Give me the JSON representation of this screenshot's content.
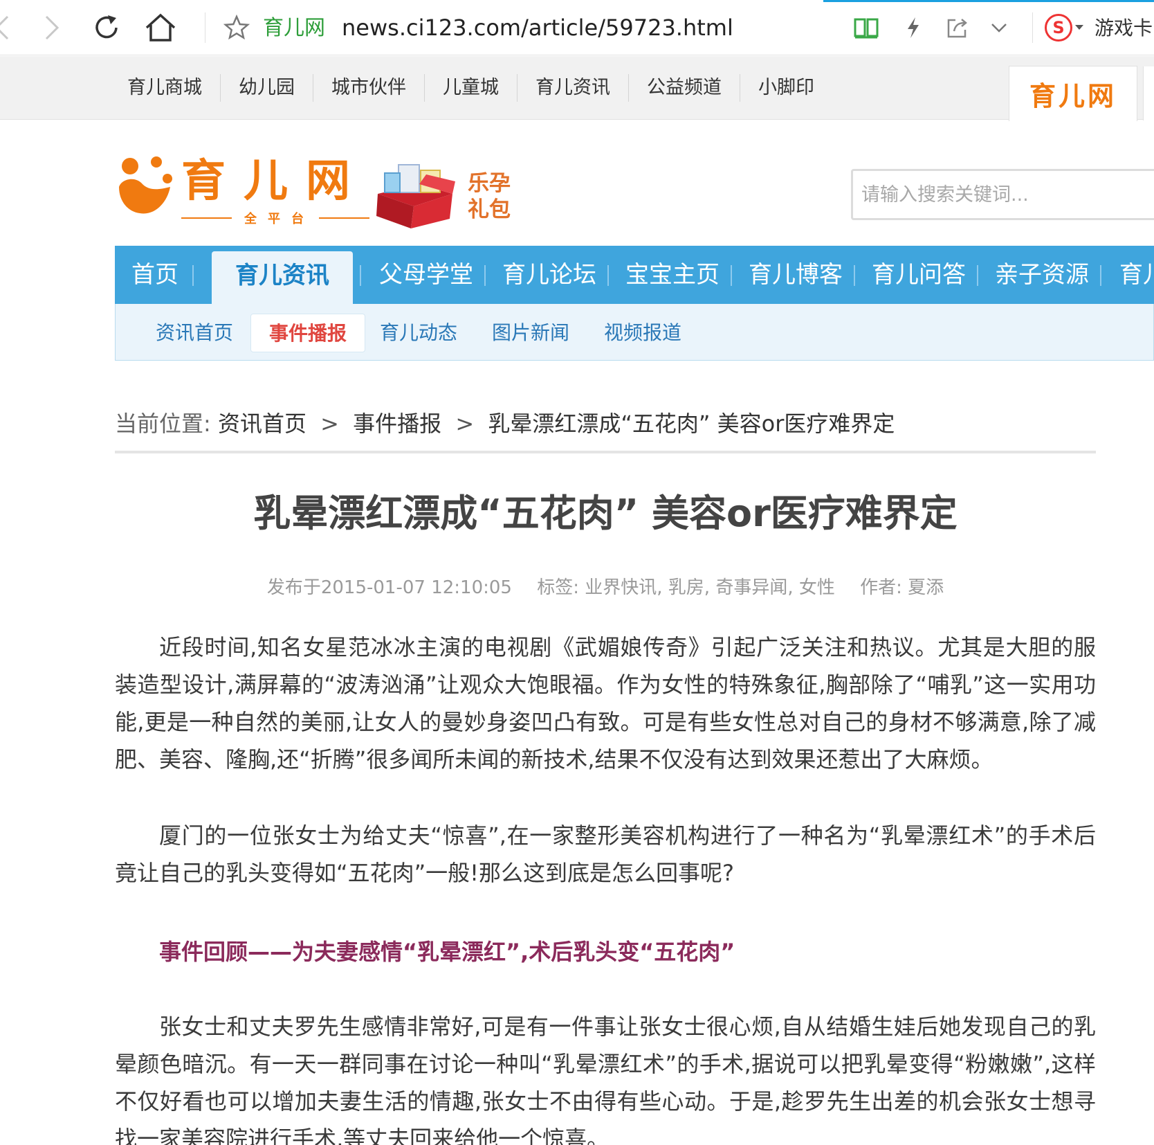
{
  "browser": {
    "site_name": "育儿网",
    "url": "news.ci123.com/article/59723.html",
    "game_text": "游戏卡",
    "colors": {
      "accent_line": "#1aa0e0",
      "site_name": "#2e9e3a"
    },
    "icons": [
      "back-icon",
      "forward-icon",
      "reload-icon",
      "home-icon",
      "star-icon",
      "reader-icon",
      "flash-icon",
      "share-icon",
      "chevron-down-icon",
      "sogou-icon"
    ]
  },
  "topnav": {
    "items": [
      "育儿商城",
      "幼儿园",
      "城市伙伴",
      "儿童城",
      "育儿资讯",
      "公益频道",
      "小脚印"
    ],
    "tab_label": "育儿网"
  },
  "logo": {
    "main": "育儿网",
    "sub": "全平台",
    "gift_text": "乐孕礼包",
    "color": "#f07a10"
  },
  "search": {
    "placeholder": "请输入搜索关键词..."
  },
  "mainnav": {
    "items": [
      "首页",
      "育儿资讯",
      "父母学堂",
      "育儿论坛",
      "宝宝主页",
      "育儿博客",
      "育儿问答",
      "亲子资源",
      "育儿"
    ],
    "active": "育儿资讯",
    "color": "#3fa5dd"
  },
  "subnav": {
    "items": [
      "资讯首页",
      "事件播报",
      "育儿动态",
      "图片新闻",
      "视频报道"
    ],
    "active": "事件播报"
  },
  "breadcrumb": {
    "label": "当前位置:",
    "items": [
      "资讯首页",
      "事件播报",
      "乳晕漂红漂成“五花肉” 美容or医疗难界定"
    ],
    "separator": ">"
  },
  "article": {
    "title": "乳晕漂红漂成“五花肉” 美容or医疗难界定",
    "published": "发布于2015-01-07 12:10:05",
    "tags": "标签: 业界快讯, 乳房, 奇事异闻, 女性",
    "author": "作者: 夏添",
    "paragraphs": [
      "近段时间,知名女星范冰冰主演的电视剧《武媚娘传奇》引起广泛关注和热议。尤其是大胆的服装造型设计,满屏幕的“波涛汹涌”让观众大饱眼福。作为女性的特殊象征,胸部除了“哺乳”这一实用功能,更是一种自然的美丽,让女人的曼妙身姿凹凸有致。可是有些女性总对自己的身材不够满意,除了减肥、美容、隆胸,还“折腾”很多闻所未闻的新技术,结果不仅没有达到效果还惹出了大麻烦。",
      "厦门的一位张女士为给丈夫“惊喜”,在一家整形美容机构进行了一种名为“乳晕漂红术”的手术后竟让自己的乳头变得如“五花肉”一般!那么这到底是怎么回事呢?",
      "张女士和丈夫罗先生感情非常好,可是有一件事让张女士很心烦,自从结婚生娃后她发现自己的乳晕颜色暗沉。有一天一群同事在讨论一种叫“乳晕漂红术”的手术,据说可以把乳晕变得“粉嫩嫩”,这样不仅好看也可以增加夫妻生活的情趣,张女士不由得有些心动。于是,趁罗先生出差的机会张女士想寻找一家美容院进行手术,等丈夫回来给他一个惊喜。"
    ],
    "subheading": "事件回顾——为夫妻感情“乳晕漂红”,术后乳头变“五花肉”",
    "subheading_color": "#8b2a5b"
  }
}
